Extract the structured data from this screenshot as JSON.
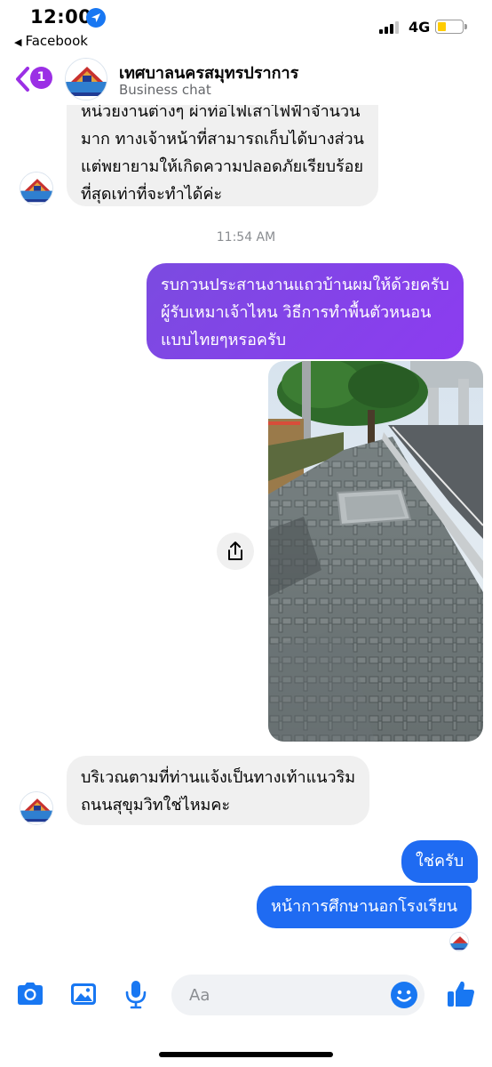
{
  "status_bar": {
    "time": "12:00",
    "back_app": "Facebook",
    "network": "4G",
    "battery_level": 0.35
  },
  "header": {
    "unread_count": "1",
    "name": "เทศบาลนครสมุทรปราการ",
    "subtitle": "Business chat"
  },
  "messages": {
    "incoming_1": {
      "lines": [
        "หน่วยงานต่างๆ ผ่าท่อไฟเสาไฟฟ้าจำนวน",
        "มาก ทางเจ้าหน้าที่สามารถเก็บได้บางส่วน",
        "แต่พยายามให้เกิดความปลอดภัยเรียบร้อย",
        "ที่สุดเท่าที่จะทำได้ค่ะ"
      ]
    },
    "timestamp": "11:54 AM",
    "outgoing_1": {
      "lines": [
        "รบกวนประสานงานแถวบ้านผมให้ด้วยครับ",
        "ผู้รับเหมาเจ้าไหน วิธีการทำพื้นตัวหนอน",
        "แบบไทยๆหรอครับ"
      ]
    },
    "incoming_2": {
      "lines": [
        "บริเวณตามที่ท่านแจ้งเป็นทางเท้าแนวริม",
        "ถนนสุขุมวิทใช่ไหมคะ"
      ]
    },
    "outgoing_2": "ใช่ครับ",
    "outgoing_3": "หน้าการศึกษานอกโรงเรียน"
  },
  "composer": {
    "placeholder": "Aa",
    "icons": [
      "camera-icon",
      "gallery-icon",
      "microphone-icon",
      "emoji-icon",
      "thumbs-up-icon"
    ]
  },
  "colors": {
    "accent_blue": "#1f6bf2",
    "purple_bubble": "#8a2be2",
    "unread_badge": "#9b2fe5",
    "incoming_bubble": "#f0f0f0"
  }
}
